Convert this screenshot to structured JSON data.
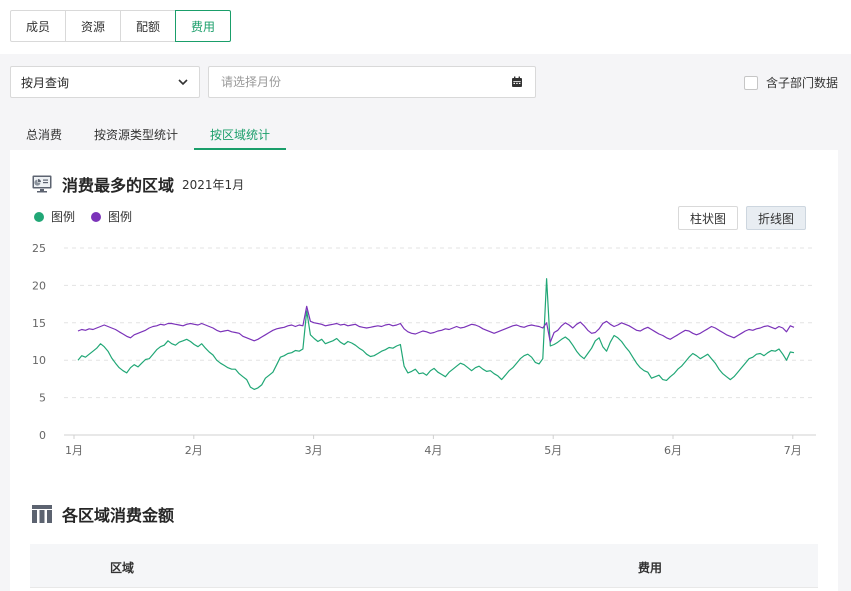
{
  "top_tabs": [
    "成员",
    "资源",
    "配额",
    "费用"
  ],
  "filters": {
    "query_mode": "按月查询",
    "date_placeholder": "请选择月份",
    "include_sub_label": "含子部门数据"
  },
  "sub_tabs": [
    "总消费",
    "按资源类型统计",
    "按区域统计"
  ],
  "chart_section": {
    "title": "消费最多的区域",
    "subtitle": "2021年1月",
    "bar_button": "柱状图",
    "line_button": "折线图"
  },
  "colors": {
    "accent": "#1a9e6a",
    "series_green": "#21a776",
    "series_purple": "#7b33b9"
  },
  "chart_data": {
    "type": "line",
    "x_labels": [
      "1月",
      "2月",
      "3月",
      "4月",
      "5月",
      "6月",
      "7月"
    ],
    "ylim": [
      0,
      25
    ],
    "y_ticks": [
      0,
      5,
      10,
      15,
      20,
      25
    ],
    "grid": true,
    "legend_position": "top-left",
    "series": [
      {
        "name": "图例",
        "color": "#21a776",
        "values": [
          10,
          10.6,
          10.4,
          10.8,
          11.2,
          11.6,
          12.2,
          11.8,
          11.2,
          10.3,
          9.6,
          9.0,
          8.6,
          8.3,
          9.0,
          9.4,
          9.1,
          9.6,
          10.1,
          10.2,
          10.8,
          11.4,
          11.8,
          12.0,
          12.6,
          12.2,
          12.0,
          12.4,
          12.6,
          12.8,
          12.5,
          12.1,
          11.8,
          12.2,
          11.6,
          11.1,
          10.7,
          10.0,
          9.6,
          9.3,
          9.0,
          8.8,
          8.8,
          8.2,
          7.8,
          7.4,
          6.4,
          6.1,
          6.3,
          6.7,
          7.6,
          8.0,
          8.4,
          9.4,
          10.4,
          10.6,
          10.9,
          11.0,
          11.3,
          11.2,
          11.5,
          16.6,
          13.4,
          12.9,
          12.5,
          12.8,
          12.2,
          12.4,
          12.6,
          12.9,
          12.4,
          12.1,
          12.5,
          12.3,
          12.0,
          11.6,
          11.3,
          10.8,
          10.5,
          10.6,
          10.9,
          11.2,
          11.4,
          11.7,
          11.6,
          11.9,
          12.1,
          9.2,
          8.3,
          8.5,
          8.8,
          8.2,
          8.3,
          8.0,
          8.6,
          8.9,
          8.4,
          8.1,
          7.8,
          8.4,
          8.8,
          9.2,
          9.6,
          9.4,
          9.0,
          8.6,
          9.0,
          9.2,
          8.8,
          8.5,
          8.6,
          8.2,
          7.9,
          7.4,
          8.0,
          8.6,
          9.0,
          9.6,
          10.2,
          10.6,
          10.8,
          10.4,
          9.7,
          9.5,
          10.2,
          20.9,
          11.9,
          12.1,
          12.4,
          12.8,
          13.1,
          12.7,
          12.0,
          11.2,
          10.6,
          10.2,
          10.9,
          11.6,
          12.6,
          13.0,
          11.8,
          11.2,
          12.4,
          13.3,
          13.0,
          12.5,
          11.8,
          11.2,
          10.4,
          9.6,
          9.0,
          8.6,
          8.4,
          7.6,
          7.8,
          8.0,
          7.4,
          7.3,
          7.8,
          8.2,
          8.8,
          9.2,
          9.8,
          10.4,
          10.9,
          10.6,
          10.2,
          10.5,
          10.8,
          10.2,
          9.6,
          8.8,
          8.2,
          7.8,
          7.4,
          7.8,
          8.4,
          9.0,
          9.6,
          10.2,
          10.4,
          10.8,
          10.9,
          10.6,
          11.0,
          11.3,
          11.2,
          11.5,
          10.8,
          10.0,
          11.1,
          11.0
        ]
      },
      {
        "name": "图例",
        "color": "#7b33b9",
        "values": [
          13.9,
          14.1,
          14.0,
          14.2,
          14.1,
          14.3,
          14.5,
          14.7,
          14.5,
          14.3,
          14.1,
          13.8,
          13.5,
          13.2,
          13.0,
          13.4,
          13.6,
          13.8,
          14.0,
          14.3,
          14.5,
          14.6,
          14.8,
          14.7,
          14.9,
          14.9,
          14.8,
          14.7,
          14.6,
          14.8,
          14.9,
          14.8,
          14.7,
          14.9,
          14.7,
          14.5,
          14.3,
          14.0,
          13.8,
          13.9,
          14.0,
          13.8,
          13.7,
          13.6,
          13.2,
          13.0,
          12.8,
          12.6,
          12.8,
          13.1,
          13.4,
          13.7,
          14.0,
          14.2,
          14.3,
          14.4,
          14.6,
          14.7,
          14.5,
          14.7,
          14.6,
          17.2,
          15.2,
          15.0,
          14.9,
          14.8,
          14.6,
          14.7,
          14.8,
          14.9,
          14.7,
          14.8,
          14.6,
          14.7,
          14.8,
          14.5,
          14.4,
          14.3,
          14.4,
          14.5,
          14.6,
          14.5,
          14.7,
          14.8,
          14.6,
          14.7,
          14.9,
          14.2,
          13.8,
          13.6,
          13.5,
          13.7,
          13.9,
          13.8,
          13.6,
          13.7,
          13.9,
          14.0,
          14.2,
          14.1,
          14.3,
          14.5,
          14.3,
          14.4,
          14.6,
          14.8,
          14.7,
          14.5,
          14.2,
          14.0,
          13.8,
          13.6,
          13.8,
          14.0,
          14.2,
          14.4,
          14.6,
          14.7,
          14.5,
          14.4,
          14.6,
          14.7,
          14.6,
          14.5,
          14.3,
          15.0,
          12.4,
          13.7,
          14.0,
          14.6,
          15.0,
          14.7,
          14.3,
          14.8,
          15.1,
          14.6,
          14.0,
          13.6,
          13.7,
          14.2,
          14.9,
          15.2,
          14.8,
          14.5,
          14.7,
          15.0,
          14.8,
          14.6,
          14.3,
          14.0,
          13.9,
          14.2,
          14.4,
          14.1,
          13.8,
          13.5,
          13.3,
          13.0,
          12.8,
          13.1,
          13.4,
          13.7,
          14.0,
          13.9,
          13.6,
          13.4,
          13.6,
          13.9,
          14.2,
          14.5,
          14.3,
          14.0,
          13.7,
          13.4,
          13.2,
          13.0,
          13.3,
          13.6,
          13.9,
          14.1,
          14.0,
          14.2,
          14.3,
          14.5,
          14.6,
          14.4,
          14.2,
          14.5,
          14.3,
          13.8,
          14.6,
          14.4
        ]
      }
    ]
  },
  "table_section": {
    "title": "各区域消费金额",
    "columns": [
      "区域",
      "费用"
    ]
  }
}
